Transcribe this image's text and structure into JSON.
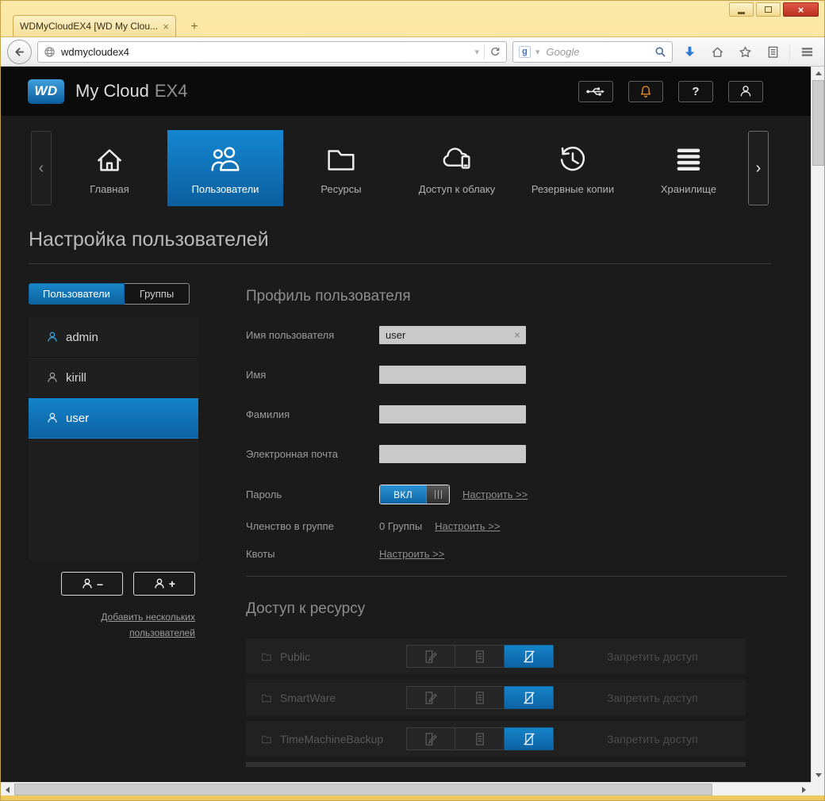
{
  "browser": {
    "tab_title": "WDMyCloudEX4 [WD My Clou...",
    "tab_close": "×",
    "new_tab": "+",
    "close_glyph": "×",
    "url": "wdmycloudex4",
    "search_engine": "Google",
    "search_engine_initial": "g"
  },
  "header": {
    "logo": "WD",
    "product": "My Cloud",
    "model": "EX4",
    "help": "?"
  },
  "nav": {
    "scroll_left": "‹",
    "scroll_right": "›",
    "items": [
      {
        "label": "Главная",
        "icon": "home-icon"
      },
      {
        "label": "Пользователи",
        "icon": "users-icon"
      },
      {
        "label": "Ресурсы",
        "icon": "folder-icon"
      },
      {
        "label": "Доступ к облаку",
        "icon": "cloud-device-icon"
      },
      {
        "label": "Резервные копии",
        "icon": "history-icon"
      },
      {
        "label": "Хранилище",
        "icon": "storage-icon"
      }
    ]
  },
  "page": {
    "title": "Настройка пользователей",
    "tab_users": "Пользователи",
    "tab_groups": "Группы",
    "users": [
      {
        "name": "admin"
      },
      {
        "name": "kirill"
      },
      {
        "name": "user"
      }
    ],
    "selected_user": "user",
    "remove_sign": "–",
    "add_sign": "+",
    "add_multiple_link": "Добавить нескольких пользователей",
    "profile": {
      "heading": "Профиль пользователя",
      "username_label": "Имя пользователя",
      "username_value": "user",
      "clear_icon": "×",
      "firstname_label": "Имя",
      "lastname_label": "Фамилия",
      "email_label": "Электронная почта",
      "password_label": "Пароль",
      "password_state": "ВКЛ",
      "groups_label": "Членство в группе",
      "groups_value": "0 Группы",
      "quota_label": "Квоты",
      "configure_link": "Настроить >>"
    },
    "shares": {
      "heading": "Доступ к ресурсу",
      "rows": [
        {
          "name": "Public",
          "access": "Запретить доступ"
        },
        {
          "name": "SmartWare",
          "access": "Запретить доступ"
        },
        {
          "name": "TimeMachineBackup",
          "access": "Запретить доступ"
        }
      ]
    }
  },
  "colors": {
    "accent_blue": "#0f72b6",
    "alert_orange": "#f29422",
    "titlebar_yellow": "#f6d87e",
    "page_bg": "#1b1b1b"
  }
}
